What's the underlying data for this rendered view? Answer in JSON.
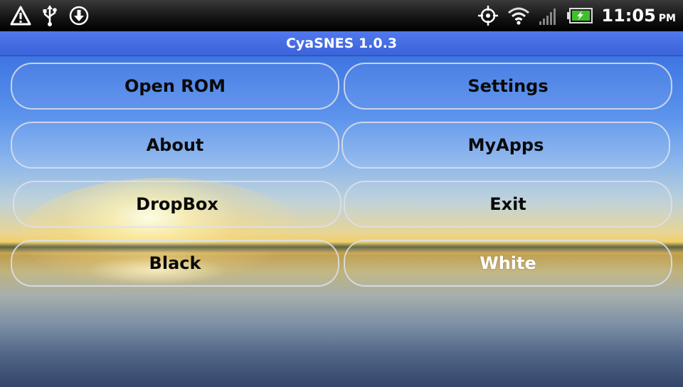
{
  "status_bar": {
    "left_icons": [
      "warning-icon",
      "usb-icon",
      "download-icon"
    ],
    "right_icons": [
      "gps-icon",
      "wifi-icon",
      "signal-icon",
      "battery-charging-icon"
    ],
    "time": "11:05",
    "ampm": "PM"
  },
  "app": {
    "title": "CyaSNES 1.0.3"
  },
  "buttons": {
    "open_rom": "Open ROM",
    "settings": "Settings",
    "about": "About",
    "myapps": "MyApps",
    "dropbox": "DropBox",
    "exit": "Exit",
    "black": "Black",
    "white": "White"
  },
  "colors": {
    "title_bar": "#3b63da",
    "status_bar": "#000000",
    "button_border": "#dce1eb",
    "battery_fill": "#3fbf2a"
  }
}
